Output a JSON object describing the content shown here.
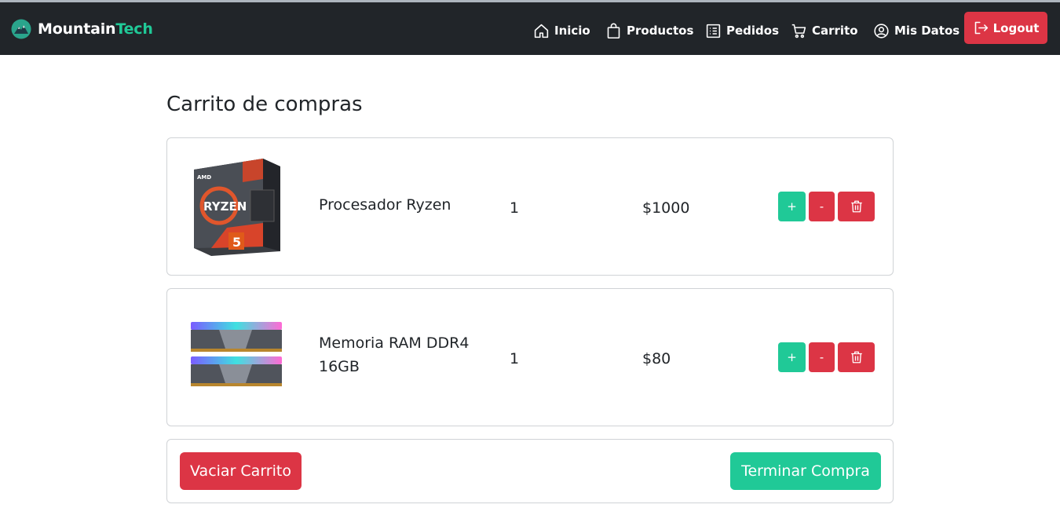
{
  "brand": {
    "name_main": "Mountain",
    "name_accent": "Tech"
  },
  "nav": {
    "items": [
      {
        "label": "Inicio",
        "icon": "house-icon"
      },
      {
        "label": "Productos",
        "icon": "shopping-bag-icon"
      },
      {
        "label": "Pedidos",
        "icon": "list-icon"
      },
      {
        "label": "Carrito",
        "icon": "cart-icon"
      },
      {
        "label": "Mis Datos",
        "icon": "user-circle-icon"
      }
    ],
    "logout_label": "Logout"
  },
  "page": {
    "title": "Carrito de compras"
  },
  "cart": {
    "items": [
      {
        "name": "Procesador Ryzen",
        "quantity": "1",
        "price": "$1000",
        "image": "ryzen-box-image"
      },
      {
        "name": "Memoria RAM DDR4 16GB",
        "quantity": "1",
        "price": "$80",
        "image": "ram-modules-image"
      }
    ],
    "plus_label": "+",
    "minus_label": "-"
  },
  "actions": {
    "empty_label": "Vaciar Carrito",
    "finish_label": "Terminar Compra"
  },
  "colors": {
    "navbar": "#212529",
    "accent": "#20c997",
    "danger": "#dc3545"
  }
}
